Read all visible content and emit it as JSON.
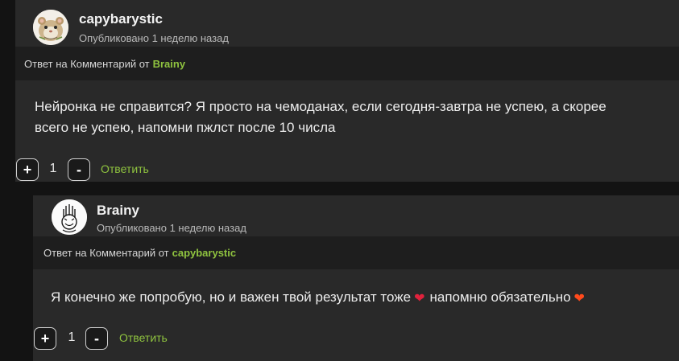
{
  "comments": [
    {
      "username": "capybarystic",
      "posted": "Опубликовано 1 неделю назад",
      "reply_prefix": "Ответ на Комментарий от",
      "reply_to": "Brainy",
      "text_lines": [
        "Нейронка не справится? Я просто на чемоданах, если сегодня-завтра не успею, а скорее",
        "всего не успею, напомни пжлст после 10 числа"
      ],
      "vote_plus": "+",
      "vote_count": "1",
      "vote_minus": "-",
      "reply_label": "Ответить"
    },
    {
      "username": "Brainy",
      "posted": "Опубликовано 1 неделю назад",
      "reply_prefix": "Ответ на Комментарий от",
      "reply_to": "capybarystic",
      "text_part1": "Я конечно же попробую, но и важен твой результат тоже",
      "text_part2": "напомню обязательно",
      "vote_plus": "+",
      "vote_count": "1",
      "vote_minus": "-",
      "reply_label": "Ответить"
    }
  ],
  "icons": {
    "heart_red": "❤",
    "heart_orange": "❤"
  },
  "colors": {
    "accent_green": "#8fc33f",
    "card_bg": "#292929",
    "reply_bar_bg": "#1e1e1e",
    "page_bg": "#131313"
  }
}
